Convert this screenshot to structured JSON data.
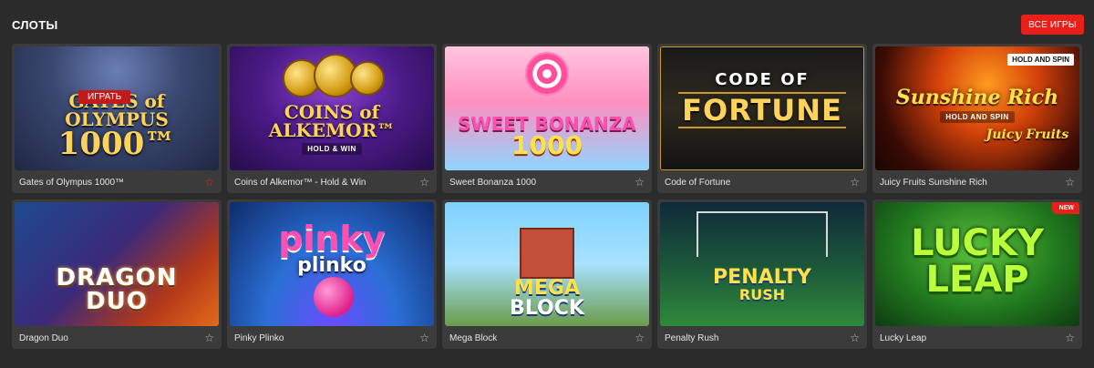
{
  "section": {
    "title": "СЛОТЫ",
    "all_games_label": "ВСЕ ИГРЫ"
  },
  "games": [
    {
      "title": "Gates of Olympus 1000™",
      "art_line1": "GATES of OLYMPUS",
      "art_line2": "1000™",
      "hover_label": "ИГРАТЬ",
      "favorite": true
    },
    {
      "title": "Coins of Alkemor™ - Hold & Win",
      "art_line1": "COINS of ALKEMOR™",
      "art_line2": "HOLD & WIN",
      "favorite": false
    },
    {
      "title": "Sweet Bonanza 1000",
      "art_line1": "SWEET BONANZA",
      "art_line2": "1000",
      "favorite": false
    },
    {
      "title": "Code of Fortune",
      "art_line1": "CODE OF",
      "art_line2": "FORTUNE",
      "favorite": false
    },
    {
      "title": "Juicy Fruits Sunshine Rich",
      "art_line1": "Sunshine Rich",
      "art_line2": "HOLD AND SPIN",
      "art_line3": "Juicy Fruits",
      "corner_tag": "HOLD AND SPIN",
      "favorite": false
    },
    {
      "title": "Dragon Duo",
      "art_line1": "DRAGON",
      "art_line2": "DUO",
      "favorite": false
    },
    {
      "title": "Pinky Plinko",
      "art_line1": "pinky",
      "art_line2": "plinko",
      "favorite": false
    },
    {
      "title": "Mega Block",
      "art_line1": "MEGA",
      "art_line2": "BLOCK",
      "favorite": false
    },
    {
      "title": "Penalty Rush",
      "art_line1": "PENALTY",
      "art_line2": "RUSH",
      "favorite": false
    },
    {
      "title": "Lucky Leap",
      "art_line1": "LUCKY",
      "art_line2": "LEAP",
      "badge": "NEW",
      "favorite": false
    }
  ],
  "colors": {
    "background": "#2b2b2b",
    "card": "#3b3b3b",
    "accent": "#e8201a"
  },
  "icons": {
    "favorite": "star-icon"
  }
}
